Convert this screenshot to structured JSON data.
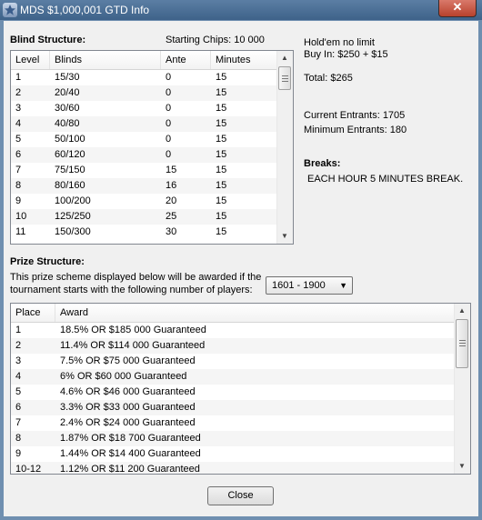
{
  "window": {
    "title": "MDS $1,000,001 GTD Info",
    "close_glyph": "✕"
  },
  "blind": {
    "heading": "Blind Structure:",
    "starting_chips": "Starting Chips: 10 000",
    "columns": [
      "Level",
      "Blinds",
      "Ante",
      "Minutes"
    ],
    "rows": [
      [
        "1",
        "15/30",
        "0",
        "15"
      ],
      [
        "2",
        "20/40",
        "0",
        "15"
      ],
      [
        "3",
        "30/60",
        "0",
        "15"
      ],
      [
        "4",
        "40/80",
        "0",
        "15"
      ],
      [
        "5",
        "50/100",
        "0",
        "15"
      ],
      [
        "6",
        "60/120",
        "0",
        "15"
      ],
      [
        "7",
        "75/150",
        "15",
        "15"
      ],
      [
        "8",
        "80/160",
        "16",
        "15"
      ],
      [
        "9",
        "100/200",
        "20",
        "15"
      ],
      [
        "10",
        "125/250",
        "25",
        "15"
      ],
      [
        "11",
        "150/300",
        "30",
        "15"
      ]
    ]
  },
  "info": {
    "game": "Hold'em no limit",
    "buy_in": "Buy In: $250 + $15",
    "total": "Total: $265",
    "current_entrants": "Current Entrants: 1705",
    "minimum_entrants": "Minimum Entrants: 180",
    "breaks_heading": "Breaks:",
    "breaks_text": "EACH HOUR 5 MINUTES BREAK."
  },
  "prize": {
    "heading": "Prize Structure:",
    "desc_line1": "This prize scheme displayed below will be awarded if the",
    "desc_line2": "tournament starts with the following number of players:",
    "players_range": "1601 - 1900",
    "columns": [
      "Place",
      "Award"
    ],
    "rows": [
      [
        "1",
        "18.5% OR $185 000 Guaranteed"
      ],
      [
        "2",
        "11.4% OR $114 000 Guaranteed"
      ],
      [
        "3",
        "7.5% OR $75 000 Guaranteed"
      ],
      [
        "4",
        "6% OR $60 000 Guaranteed"
      ],
      [
        "5",
        "4.6% OR $46 000 Guaranteed"
      ],
      [
        "6",
        "3.3% OR $33 000 Guaranteed"
      ],
      [
        "7",
        "2.4% OR $24 000 Guaranteed"
      ],
      [
        "8",
        "1.87% OR $18 700 Guaranteed"
      ],
      [
        "9",
        "1.44% OR $14 400 Guaranteed"
      ],
      [
        "10-12",
        "1.12% OR $11 200 Guaranteed"
      ]
    ]
  },
  "close_button": "Close"
}
